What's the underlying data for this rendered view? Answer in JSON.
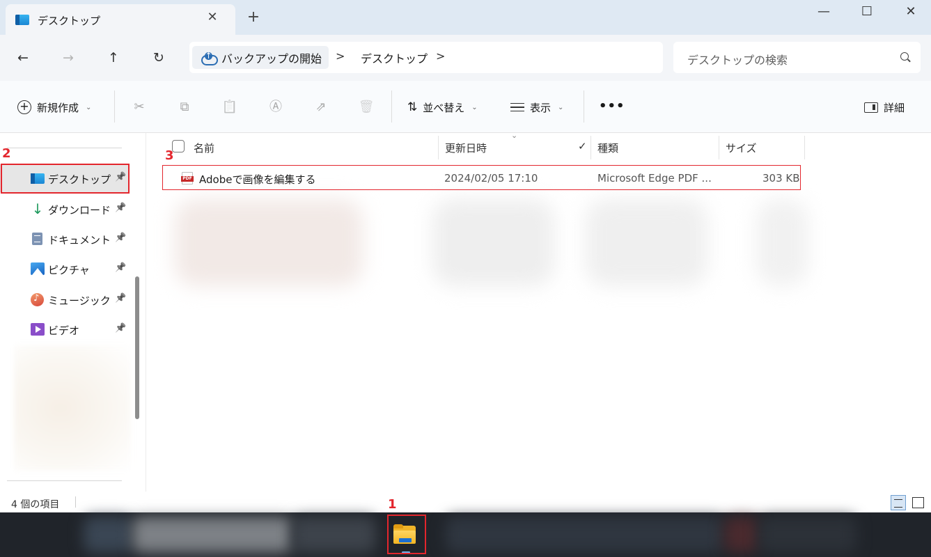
{
  "window": {
    "tab_title": "デスクトップ",
    "close_tab_glyph": "✕",
    "new_tab_glyph": "+",
    "minimize_glyph": "—",
    "maximize_glyph": "☐",
    "close_glyph": "✕"
  },
  "nav": {
    "back_glyph": "←",
    "forward_glyph": "→",
    "up_glyph": "↑",
    "refresh_glyph": "↻"
  },
  "breadcrumb": {
    "root": "バックアップの開始",
    "separator": ">",
    "current": "デスクトップ"
  },
  "search": {
    "placeholder": "デスクトップの検索"
  },
  "commandbar": {
    "new": "新規作成",
    "chevron": "⌄",
    "cut_glyph": "✂",
    "copy_glyph": "⧉",
    "paste_glyph": "📋",
    "rename_glyph": "Ⓐ",
    "share_glyph": "⇗",
    "delete_glyph": "🗑",
    "sort": "並べ替え",
    "sort_glyph": "⇅",
    "view": "表示",
    "more": "•••",
    "details": "詳細"
  },
  "sidebar": {
    "pin_glyph": "📌",
    "items": [
      {
        "label": "デスクトップ",
        "icon": "desktop-icon",
        "selected": true
      },
      {
        "label": "ダウンロード",
        "icon": "download-icon",
        "glyph": "↓"
      },
      {
        "label": "ドキュメント",
        "icon": "document-icon"
      },
      {
        "label": "ピクチャ",
        "icon": "pictures-icon"
      },
      {
        "label": "ミュージック",
        "icon": "music-icon"
      },
      {
        "label": "ビデオ",
        "icon": "video-icon"
      }
    ]
  },
  "filelist": {
    "columns": {
      "name": "名前",
      "modified": "更新日時",
      "type": "種類",
      "size": "サイズ"
    },
    "sort_indicator": "⌄",
    "type_check": "✓",
    "rows": [
      {
        "name": "Adobeで画像を編集する",
        "modified": "2024/02/05 17:10",
        "type": "Microsoft Edge PDF ...",
        "size": "303 KB",
        "icon": "pdf-file-icon"
      }
    ]
  },
  "status": {
    "item_count": "4 個の項目"
  },
  "annotations": {
    "step1": "1",
    "step2": "2",
    "step3": "3",
    "color": "#e3262d"
  },
  "colors": {
    "titlebar": "#dfe9f3",
    "toolbar": "#f3f5f8",
    "taskbar": "#20242a",
    "selected_item": "#e6e6e6",
    "accent": "#1b86d4"
  }
}
